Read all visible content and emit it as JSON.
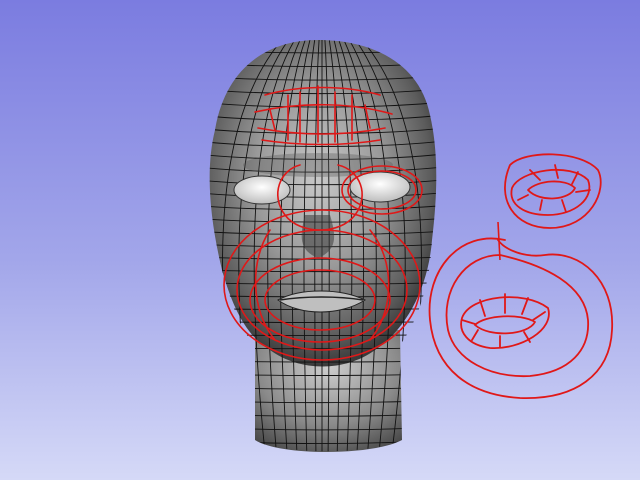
{
  "scene": {
    "background_top": "#7b7ce0",
    "background_bottom": "#d5d9f7",
    "mesh_color": "#8a8a8a",
    "wire_color": "#111111",
    "annotation_color": "#e01818",
    "eye_color": "#f2f2f2"
  },
  "elements": {
    "head": "head-mesh",
    "annotations": "topology-sketch",
    "diagram_eye": "eye-loop-diagram",
    "diagram_mouth": "mouth-loop-diagram"
  }
}
